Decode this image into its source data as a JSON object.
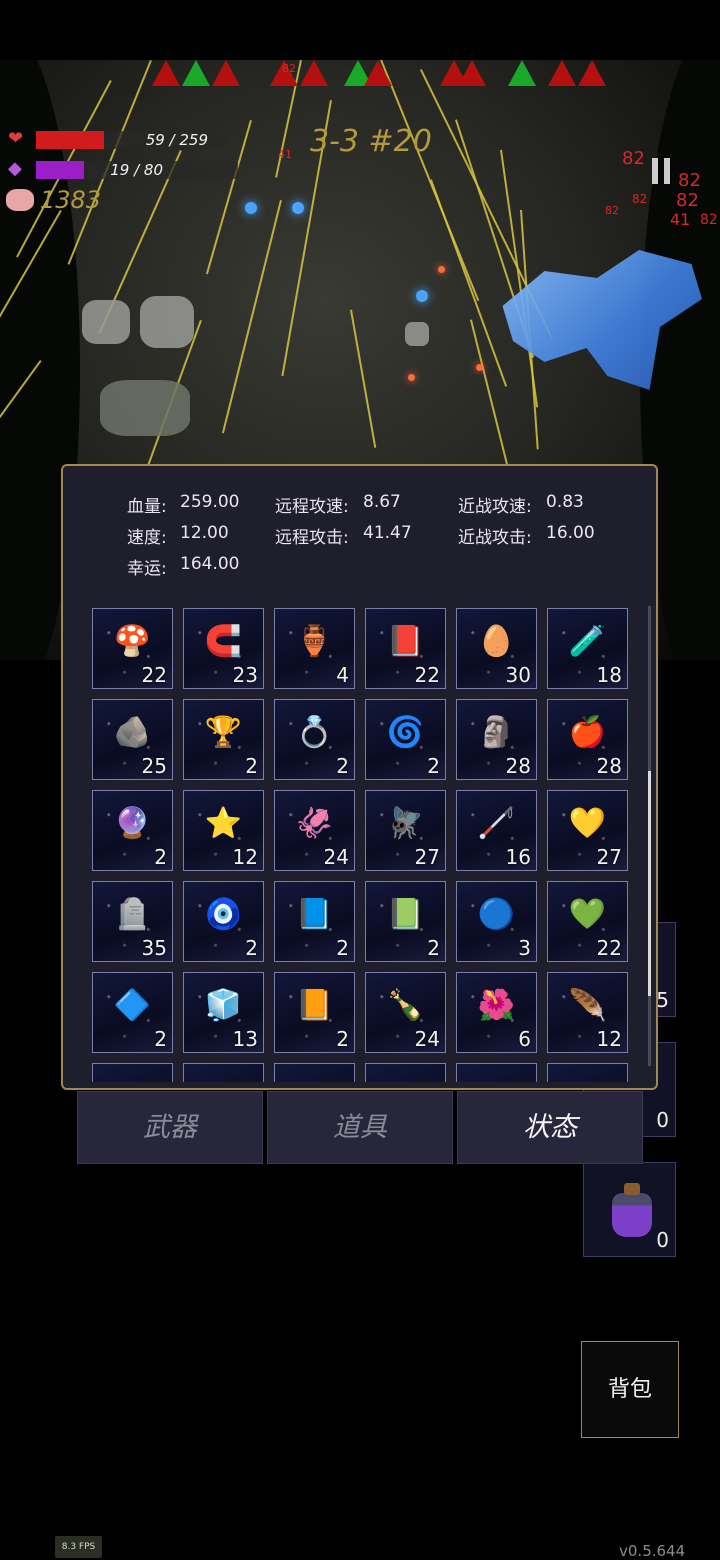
{
  "hud": {
    "hp_text": "59 / 259",
    "hp_fraction": 0.228,
    "mana_text": "19 / 80",
    "mana_fraction": 0.2375,
    "gold": "1383",
    "wave": "3-3 #20",
    "hp_color": "#d01c1c",
    "mana_color": "#9b1ec8"
  },
  "damage_numbers": [
    "82",
    "82",
    "82",
    "82",
    "82",
    "82",
    "41",
    "41",
    "82"
  ],
  "stats": [
    {
      "label": "血量:",
      "value": "259.00"
    },
    {
      "label": "远程攻速:",
      "value": "8.67"
    },
    {
      "label": "近战攻速:",
      "value": "0.83"
    },
    {
      "label": "速度:",
      "value": "12.00"
    },
    {
      "label": "远程攻击:",
      "value": "41.47"
    },
    {
      "label": "近战攻击:",
      "value": "16.00"
    },
    {
      "label": "幸运:",
      "value": "164.00"
    }
  ],
  "items": [
    {
      "icon": "mushroom-icon",
      "glyph": "🍄",
      "count": "22"
    },
    {
      "icon": "horseshoe-icon",
      "glyph": "🧲",
      "count": "23"
    },
    {
      "icon": "heart-urn-icon",
      "glyph": "🏺",
      "count": "4"
    },
    {
      "icon": "spellbook-icon",
      "glyph": "📕",
      "count": "22"
    },
    {
      "icon": "egg-icon",
      "glyph": "🥚",
      "count": "30"
    },
    {
      "icon": "green-potion-icon",
      "glyph": "🧪",
      "count": "18"
    },
    {
      "icon": "stone-icon",
      "glyph": "🪨",
      "count": "25"
    },
    {
      "icon": "star-trophy-icon",
      "glyph": "🏆",
      "count": "2"
    },
    {
      "icon": "cross-ring-icon",
      "glyph": "💍",
      "count": "2"
    },
    {
      "icon": "spiral-rune-icon",
      "glyph": "🌀",
      "count": "2"
    },
    {
      "icon": "hooded-figure-icon",
      "glyph": "🗿",
      "count": "28"
    },
    {
      "icon": "apple-icon",
      "glyph": "🍎",
      "count": "28"
    },
    {
      "icon": "crystal-orb-icon",
      "glyph": "🔮",
      "count": "2"
    },
    {
      "icon": "gold-star-icon",
      "glyph": "⭐",
      "count": "12"
    },
    {
      "icon": "tentacle-icon",
      "glyph": "🦑",
      "count": "24"
    },
    {
      "icon": "dragonfly-icon",
      "glyph": "🪰",
      "count": "27"
    },
    {
      "icon": "cane-icon",
      "glyph": "🦯",
      "count": "16"
    },
    {
      "icon": "yellow-crystal-icon",
      "glyph": "💛",
      "count": "27"
    },
    {
      "icon": "tombstone-icon",
      "glyph": "🪦",
      "count": "35"
    },
    {
      "icon": "eye-rune-icon",
      "glyph": "🧿",
      "count": "2"
    },
    {
      "icon": "blue-book-icon",
      "glyph": "📘",
      "count": "2"
    },
    {
      "icon": "skull-book-icon",
      "glyph": "📗",
      "count": "2"
    },
    {
      "icon": "rainbow-orb-icon",
      "glyph": "🔵",
      "count": "3"
    },
    {
      "icon": "green-crystal-icon",
      "glyph": "💚",
      "count": "22"
    },
    {
      "icon": "arrow-rune-icon",
      "glyph": "🔷",
      "count": "2"
    },
    {
      "icon": "cube-frame-icon",
      "glyph": "🧊",
      "count": "13"
    },
    {
      "icon": "orange-book-icon",
      "glyph": "📙",
      "count": "2"
    },
    {
      "icon": "bottle-icon",
      "glyph": "🍾",
      "count": "24"
    },
    {
      "icon": "flower-icon",
      "glyph": "🌺",
      "count": "6"
    },
    {
      "icon": "feather-icon",
      "glyph": "🪶",
      "count": "12"
    }
  ],
  "tabs": [
    {
      "label": "武器",
      "active": false
    },
    {
      "label": "道具",
      "active": false
    },
    {
      "label": "状态",
      "active": true
    }
  ],
  "side_slots": [
    {
      "count": "5"
    },
    {
      "count": "0"
    },
    {
      "count": "0",
      "icon": "purple-potion-icon"
    }
  ],
  "bag_label": "背包",
  "fps": "8.3 FPS",
  "version": "v0.5.644"
}
